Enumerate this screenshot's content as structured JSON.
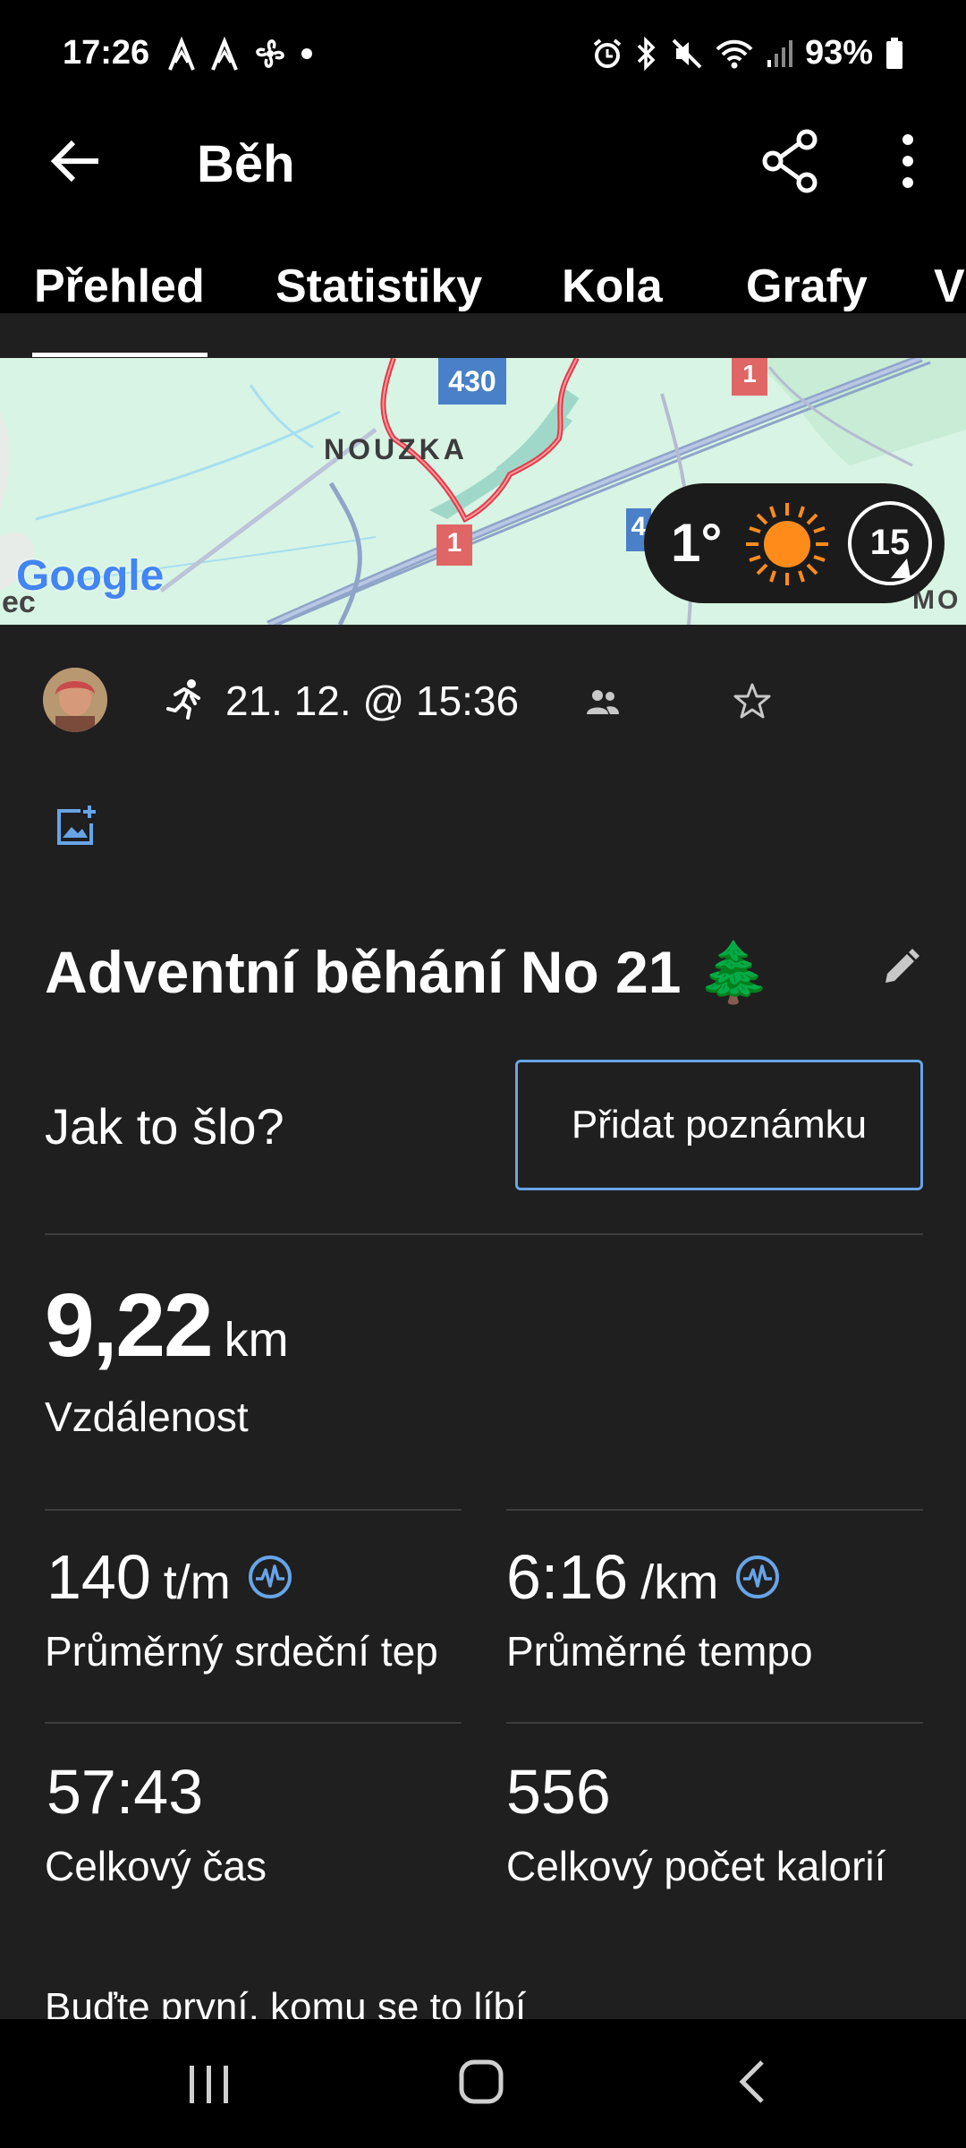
{
  "status_bar": {
    "time": "17:26",
    "battery": "93%",
    "icons_left": [
      "strava-icon",
      "strava-icon",
      "fan-icon",
      "dot-icon"
    ],
    "icons_right": [
      "alarm-icon",
      "bluetooth-icon",
      "mute-icon",
      "wifi-icon",
      "signal-icon",
      "battery-icon"
    ]
  },
  "app_bar": {
    "title": "Běh",
    "actions": [
      "back-arrow-icon",
      "share-icon",
      "more-vert-icon"
    ]
  },
  "tabs": [
    {
      "label": "Přehled",
      "active": true
    },
    {
      "label": "Statistiky",
      "active": false
    },
    {
      "label": "Kola",
      "active": false
    },
    {
      "label": "Grafy",
      "active": false
    },
    {
      "label": "V",
      "active": false
    }
  ],
  "map": {
    "place_label": "NOUZKA",
    "road_430": "430",
    "road_1_top": "1",
    "road_1_bottom": "1",
    "road_4": "4",
    "edge_label_left": "ec",
    "edge_label_right": "MO",
    "google_logo": "Google",
    "weather": {
      "temperature": "1°",
      "wind_speed": "15",
      "icon": "sun-icon"
    },
    "colors": {
      "background": "#d8f4e4",
      "route": "#e63946",
      "roads": "#8ea4c8"
    }
  },
  "activity": {
    "date": "21. 12. @ 15:36",
    "title": "Adventní běhání No 21 🌲",
    "feel_question": "Jak to šlo?",
    "add_note_button": "Přidat poznámku"
  },
  "metrics": {
    "distance": {
      "value": "9,22",
      "unit": "km",
      "label": "Vzdálenost"
    },
    "heart_rate": {
      "value": "140",
      "unit": "t/m",
      "label": "Průměrný srdeční tep"
    },
    "pace": {
      "value": "6:16",
      "unit": "/km",
      "label": "Průměrné tempo"
    },
    "time": {
      "value": "57:43",
      "label": "Celkový čas"
    },
    "calories": {
      "value": "556",
      "label": "Celkový počet kalorií"
    }
  },
  "likes_text": "Buďte první, komu se to líbí",
  "accent_color": "#67a4e8",
  "nav_bar": [
    "recents-icon",
    "home-icon",
    "back-icon"
  ]
}
